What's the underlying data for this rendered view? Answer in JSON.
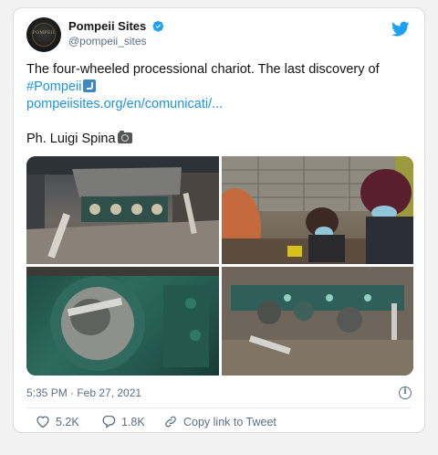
{
  "tweet": {
    "author_name": "Pompeii Sites",
    "author_handle": "@pompeii_sites",
    "avatar_text": "POMPEII",
    "text_line1": "The four-wheeled processional chariot. The last discovery of ",
    "hashtag": "#Pompeii",
    "link": "pompeiisites.org/en/comunicati/...",
    "credit": "Ph. Luigi Spina",
    "timestamp": "5:35 PM · Feb 27, 2021",
    "likes": "5.2K",
    "replies": "1.8K",
    "copy_link_label": "Copy link to Tweet"
  },
  "colors": {
    "accent": "#1da1f2",
    "link": "#1b95e0",
    "secondary_text": "#5b7083"
  },
  "icons": [
    "verified-badge-icon",
    "twitter-bird-icon",
    "info-icon",
    "heart-icon",
    "reply-icon",
    "link-icon",
    "arrow-curving-right-emoji",
    "camera-emoji"
  ]
}
